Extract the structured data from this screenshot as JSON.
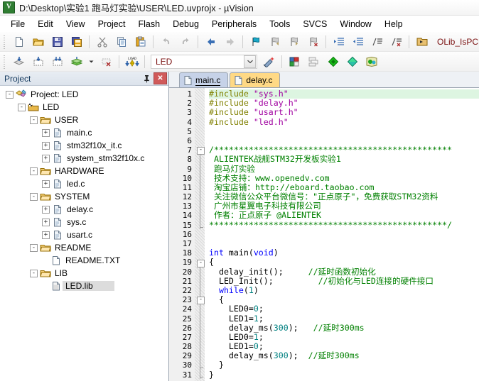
{
  "window": {
    "title": "D:\\Desktop\\实验1 跑马灯实验\\USER\\LED.uvprojx - µVision",
    "app_icon": "keil-uvision-icon"
  },
  "menubar": {
    "items": [
      {
        "label": "File"
      },
      {
        "label": "Edit"
      },
      {
        "label": "View"
      },
      {
        "label": "Project"
      },
      {
        "label": "Flash"
      },
      {
        "label": "Debug"
      },
      {
        "label": "Peripherals"
      },
      {
        "label": "Tools"
      },
      {
        "label": "SVCS"
      },
      {
        "label": "Window"
      },
      {
        "label": "Help"
      }
    ]
  },
  "toolbar_main": {
    "buttons": [
      {
        "name": "new-file-icon",
        "title": "New"
      },
      {
        "name": "open-file-icon",
        "title": "Open"
      },
      {
        "name": "save-icon",
        "title": "Save"
      },
      {
        "name": "save-all-icon",
        "title": "Save All"
      },
      {
        "name": "cut-icon",
        "title": "Cut"
      },
      {
        "name": "copy-icon",
        "title": "Copy"
      },
      {
        "name": "paste-icon",
        "title": "Paste"
      },
      {
        "name": "undo-icon",
        "title": "Undo"
      },
      {
        "name": "redo-icon",
        "title": "Redo"
      },
      {
        "name": "navigate-back-icon",
        "title": "Back"
      },
      {
        "name": "navigate-forward-icon",
        "title": "Forward"
      },
      {
        "name": "bookmark-toggle-icon",
        "title": "Insert/Remove Bookmark"
      },
      {
        "name": "bookmark-prev-icon",
        "title": "Previous Bookmark"
      },
      {
        "name": "bookmark-next-icon",
        "title": "Next Bookmark"
      },
      {
        "name": "bookmark-clear-icon",
        "title": "Clear All Bookmarks"
      },
      {
        "name": "indent-icon",
        "title": "Indent"
      },
      {
        "name": "outdent-icon",
        "title": "Outdent"
      },
      {
        "name": "comment-icon",
        "title": "Comment"
      },
      {
        "name": "uncomment-icon",
        "title": "Uncomment"
      },
      {
        "name": "open-folder-browse-icon",
        "title": "Open Folder"
      }
    ],
    "status_text": "OLib_IsPCMode_NotWrit"
  },
  "toolbar_build": {
    "buttons": [
      {
        "name": "translate-icon",
        "title": "Translate"
      },
      {
        "name": "build-icon",
        "title": "Build"
      },
      {
        "name": "rebuild-icon",
        "title": "Rebuild"
      },
      {
        "name": "batch-build-icon",
        "title": "Batch Build"
      },
      {
        "name": "batch-build-dropdown-icon",
        "title": "Batch Build Options"
      },
      {
        "name": "stop-build-icon",
        "title": "Stop Build"
      },
      {
        "name": "download-icon",
        "title": "Download"
      }
    ],
    "target_label": "LED",
    "target_dropdown_icon": "chevron-down-icon",
    "right_buttons": [
      {
        "name": "target-options-icon",
        "title": "Options for Target"
      },
      {
        "name": "manage-project-items-icon",
        "title": "Manage Project Items"
      },
      {
        "name": "multi-project-icon",
        "title": "Manage Multi-Project"
      },
      {
        "name": "pack-installer-icon",
        "title": "Pack Installer"
      },
      {
        "name": "configure-rte-icon",
        "title": "Manage Run-Time Environment"
      },
      {
        "name": "select-software-packs-icon",
        "title": "Select Software Packs"
      }
    ]
  },
  "project_pane": {
    "title": "Project",
    "pin_icon": "pin-icon",
    "close_icon": "close-icon",
    "tree": [
      {
        "label": "Project: LED",
        "depth": 0,
        "expander": "-",
        "icon": "project-icon",
        "selected": false
      },
      {
        "label": "LED",
        "depth": 1,
        "expander": "-",
        "icon": "target-icon",
        "selected": false
      },
      {
        "label": "USER",
        "depth": 2,
        "expander": "-",
        "icon": "folder-icon",
        "selected": false
      },
      {
        "label": "main.c",
        "depth": 3,
        "expander": "+",
        "icon": "c-file-icon",
        "selected": false
      },
      {
        "label": "stm32f10x_it.c",
        "depth": 3,
        "expander": "+",
        "icon": "c-file-icon",
        "selected": false
      },
      {
        "label": "system_stm32f10x.c",
        "depth": 3,
        "expander": "+",
        "icon": "c-file-icon",
        "selected": false
      },
      {
        "label": "HARDWARE",
        "depth": 2,
        "expander": "-",
        "icon": "folder-icon",
        "selected": false
      },
      {
        "label": "led.c",
        "depth": 3,
        "expander": "+",
        "icon": "c-file-icon",
        "selected": false
      },
      {
        "label": "SYSTEM",
        "depth": 2,
        "expander": "-",
        "icon": "folder-icon",
        "selected": false
      },
      {
        "label": "delay.c",
        "depth": 3,
        "expander": "+",
        "icon": "c-file-icon",
        "selected": false
      },
      {
        "label": "sys.c",
        "depth": 3,
        "expander": "+",
        "icon": "c-file-icon",
        "selected": false
      },
      {
        "label": "usart.c",
        "depth": 3,
        "expander": "+",
        "icon": "c-file-icon",
        "selected": false
      },
      {
        "label": "README",
        "depth": 2,
        "expander": "-",
        "icon": "folder-icon",
        "selected": false
      },
      {
        "label": "README.TXT",
        "depth": 3,
        "expander": "",
        "icon": "txt-file-icon",
        "selected": false
      },
      {
        "label": "LIB",
        "depth": 2,
        "expander": "-",
        "icon": "folder-icon",
        "selected": false
      },
      {
        "label": "LED.lib",
        "depth": 3,
        "expander": "",
        "icon": "lib-file-icon",
        "selected": true
      }
    ]
  },
  "editor": {
    "tabs": [
      {
        "label": "main.c",
        "active": true,
        "icon": "c-file-icon"
      },
      {
        "label": "delay.c",
        "active": false,
        "icon": "c-file-icon"
      }
    ],
    "cursor_line": 1,
    "first_line": 1,
    "last_line": 31,
    "lines": [
      {
        "n": 1,
        "tokens": [
          {
            "t": "#include ",
            "c": "pre"
          },
          {
            "t": "\"sys.h\"",
            "c": "str"
          }
        ]
      },
      {
        "n": 2,
        "tokens": [
          {
            "t": "#include ",
            "c": "pre"
          },
          {
            "t": "\"delay.h\"",
            "c": "str"
          }
        ]
      },
      {
        "n": 3,
        "tokens": [
          {
            "t": "#include ",
            "c": "pre"
          },
          {
            "t": "\"usart.h\"",
            "c": "str"
          }
        ]
      },
      {
        "n": 4,
        "tokens": [
          {
            "t": "#include ",
            "c": "pre"
          },
          {
            "t": "\"led.h\"",
            "c": "str"
          }
        ]
      },
      {
        "n": 5,
        "tokens": []
      },
      {
        "n": 6,
        "tokens": []
      },
      {
        "n": 7,
        "tokens": [
          {
            "t": "/************************************************",
            "c": "cmt"
          }
        ]
      },
      {
        "n": 8,
        "tokens": [
          {
            "t": " ALIENTEK战舰STM32开发板实验1",
            "c": "cmt"
          }
        ]
      },
      {
        "n": 9,
        "tokens": [
          {
            "t": " 跑马灯实验",
            "c": "cmt"
          }
        ]
      },
      {
        "n": 10,
        "tokens": [
          {
            "t": " 技术支持：www.openedv.com",
            "c": "cmt"
          }
        ]
      },
      {
        "n": 11,
        "tokens": [
          {
            "t": " 淘宝店铺：http://eboard.taobao.com",
            "c": "cmt"
          }
        ]
      },
      {
        "n": 12,
        "tokens": [
          {
            "t": " 关注微信公众平台微信号：\"正点原子\"，免费获取STM32资料",
            "c": "cmt"
          }
        ]
      },
      {
        "n": 13,
        "tokens": [
          {
            "t": " 广州市星翼电子科技有限公司",
            "c": "cmt"
          }
        ]
      },
      {
        "n": 14,
        "tokens": [
          {
            "t": " 作者：正点原子 @ALIENTEK",
            "c": "cmt"
          }
        ]
      },
      {
        "n": 15,
        "tokens": [
          {
            "t": "************************************************/",
            "c": "cmt"
          }
        ]
      },
      {
        "n": 16,
        "tokens": []
      },
      {
        "n": 17,
        "tokens": []
      },
      {
        "n": 18,
        "tokens": [
          {
            "t": "int ",
            "c": "kw"
          },
          {
            "t": "main(",
            "c": "plain"
          },
          {
            "t": "void",
            "c": "kw"
          },
          {
            "t": ")",
            "c": "plain"
          }
        ]
      },
      {
        "n": 19,
        "tokens": [
          {
            "t": "{",
            "c": "plain"
          }
        ]
      },
      {
        "n": 20,
        "tokens": [
          {
            "t": "  delay_init();     ",
            "c": "plain"
          },
          {
            "t": "//延时函数初始化",
            "c": "cmt"
          }
        ]
      },
      {
        "n": 21,
        "tokens": [
          {
            "t": "  LED_Init();         ",
            "c": "plain"
          },
          {
            "t": "//初始化与LED连接的硬件接口",
            "c": "cmt"
          }
        ]
      },
      {
        "n": 22,
        "tokens": [
          {
            "t": "  while",
            "c": "kw"
          },
          {
            "t": "(",
            "c": "plain"
          },
          {
            "t": "1",
            "c": "num"
          },
          {
            "t": ")",
            "c": "plain"
          }
        ]
      },
      {
        "n": 23,
        "tokens": [
          {
            "t": "  {",
            "c": "plain"
          }
        ]
      },
      {
        "n": 24,
        "tokens": [
          {
            "t": "    LED0=",
            "c": "plain"
          },
          {
            "t": "0",
            "c": "num"
          },
          {
            "t": ";",
            "c": "plain"
          }
        ]
      },
      {
        "n": 25,
        "tokens": [
          {
            "t": "    LED1=",
            "c": "plain"
          },
          {
            "t": "1",
            "c": "num"
          },
          {
            "t": ";",
            "c": "plain"
          }
        ]
      },
      {
        "n": 26,
        "tokens": [
          {
            "t": "    delay_ms(",
            "c": "plain"
          },
          {
            "t": "300",
            "c": "num"
          },
          {
            "t": ");   ",
            "c": "plain"
          },
          {
            "t": "//延时300ms",
            "c": "cmt"
          }
        ]
      },
      {
        "n": 27,
        "tokens": [
          {
            "t": "    LED0=",
            "c": "plain"
          },
          {
            "t": "1",
            "c": "num"
          },
          {
            "t": ";",
            "c": "plain"
          }
        ]
      },
      {
        "n": 28,
        "tokens": [
          {
            "t": "    LED1=",
            "c": "plain"
          },
          {
            "t": "0",
            "c": "num"
          },
          {
            "t": ";",
            "c": "plain"
          }
        ]
      },
      {
        "n": 29,
        "tokens": [
          {
            "t": "    delay_ms(",
            "c": "plain"
          },
          {
            "t": "300",
            "c": "num"
          },
          {
            "t": ");  ",
            "c": "plain"
          },
          {
            "t": "//延时300ms",
            "c": "cmt"
          }
        ]
      },
      {
        "n": 30,
        "tokens": [
          {
            "t": "  }",
            "c": "plain"
          }
        ]
      },
      {
        "n": 31,
        "tokens": [
          {
            "t": "}",
            "c": "plain"
          }
        ]
      }
    ]
  },
  "colors": {
    "keyword": "#0000ff",
    "preprocessor": "#808000",
    "string": "#a000a0",
    "comment": "#008000",
    "number": "#008080",
    "current_line": "#ddf5e1",
    "selection": "#dcdcdc",
    "tab_active": "#c6d2e8",
    "tab_inactive": "#ffd985",
    "target_text": "#7a1010"
  }
}
